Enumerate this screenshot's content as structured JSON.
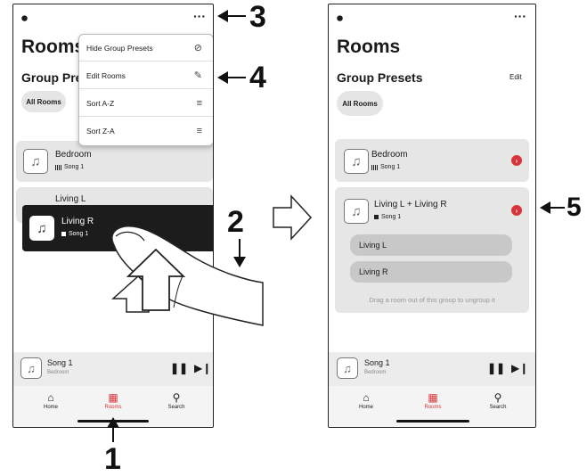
{
  "left_screen": {
    "title": "Rooms",
    "group_presets_label": "Group Pres",
    "chip_label": "All Rooms",
    "menu": {
      "items": [
        {
          "label": "Hide Group Presets",
          "icon": "⊘"
        },
        {
          "label": "Edit Rooms",
          "icon": "✎"
        },
        {
          "label": "Sort A-Z",
          "icon": "≡"
        },
        {
          "label": "Sort Z-A",
          "icon": "≡"
        }
      ]
    },
    "rooms": [
      {
        "name": "Bedroom",
        "song": "Song 1"
      },
      {
        "name": "Living L",
        "song": ""
      },
      {
        "name": "Living R",
        "song": "Song 1"
      }
    ],
    "now_playing": {
      "song": "Song 1",
      "room": "Bedroom"
    },
    "tabs": [
      {
        "label": "Home",
        "icon": "home-icon"
      },
      {
        "label": "Rooms",
        "icon": "rooms-icon"
      },
      {
        "label": "Search",
        "icon": "search-icon"
      }
    ]
  },
  "right_screen": {
    "title": "Rooms",
    "group_presets_label": "Group Presets",
    "edit_label": "Edit",
    "chip_label": "All Rooms",
    "rooms": [
      {
        "name": "Bedroom",
        "song": "Song 1"
      },
      {
        "name": "Living L + Living R",
        "song": "Song 1"
      }
    ],
    "group_members": [
      "Living L",
      "Living R"
    ],
    "hint": "Drag a room out of this group to ungroup it",
    "now_playing": {
      "song": "Song 1",
      "room": "Bedroom"
    },
    "tabs": [
      {
        "label": "Home",
        "icon": "home-icon"
      },
      {
        "label": "Rooms",
        "icon": "rooms-icon"
      },
      {
        "label": "Search",
        "icon": "search-icon"
      }
    ]
  },
  "callouts": [
    "1",
    "2",
    "3",
    "4",
    "5"
  ],
  "colors": {
    "accent_red": "#d9343a",
    "card": "#e6e6e6",
    "dark_card": "#1c1c1c"
  }
}
